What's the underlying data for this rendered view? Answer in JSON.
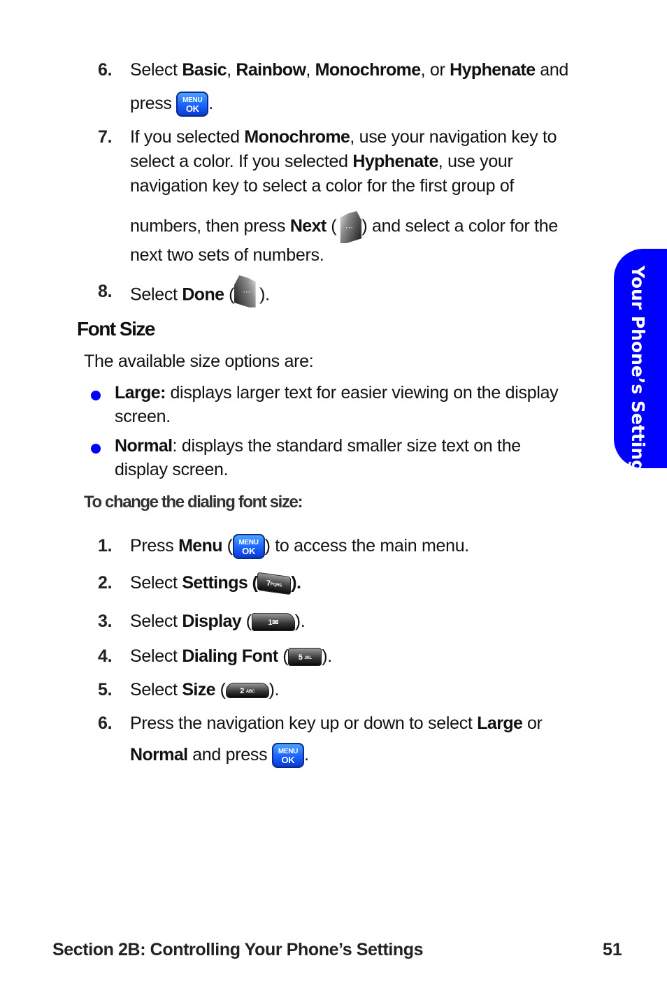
{
  "steps_top": [
    {
      "number": "6.",
      "parts": {
        "a": "Select ",
        "b1": "Basic",
        "c": ", ",
        "b2": "Rainbow",
        "d": ", ",
        "b3": "Monochrome",
        "e": ", or ",
        "b4": "Hyphenate",
        "f": " and",
        "g": "press ",
        "h": "."
      }
    },
    {
      "number": "7.",
      "parts": {
        "a": "If you selected ",
        "b1": "Monochrome",
        "c": ", use your navigation key to",
        "d": "select a color. If you selected ",
        "b2": "Hyphenate",
        "e": ", use your",
        "f": "navigation key to select a color for the first group of",
        "g": "numbers, then press ",
        "b3": "Next",
        "h": " (",
        "i": ") and select a color for the",
        "j": "next two sets of numbers."
      }
    },
    {
      "number": "8.",
      "parts": {
        "a": "Select ",
        "b1": "Done",
        "c": " (",
        "d": ")."
      }
    }
  ],
  "section": {
    "heading": "Font Size",
    "intro": "The available size options are:",
    "bullets": [
      {
        "term": "Large:",
        "text": " displays larger text for easier viewing on the display",
        "text2": "screen."
      },
      {
        "term": "Normal",
        "text": ": displays the standard smaller size text on the",
        "text2": "display screen."
      }
    ],
    "subheading": "To change the dialing font size:"
  },
  "steps_bottom": [
    {
      "number": "1.",
      "parts": {
        "a": "Press ",
        "b1": "Menu",
        "c": " (",
        "d": ") to access the main menu."
      }
    },
    {
      "number": "2.",
      "parts": {
        "a": "Select ",
        "b1": "Settings (",
        "d": ")."
      }
    },
    {
      "number": "3.",
      "parts": {
        "a": "Select ",
        "b1": "Display",
        "c": " (",
        "d": ")."
      }
    },
    {
      "number": "4.",
      "parts": {
        "a": "Select ",
        "b1": "Dialing Font",
        "c": " (",
        "d": ")."
      }
    },
    {
      "number": "5.",
      "parts": {
        "a": "Select ",
        "b1": "Size",
        "c": " (",
        "d": ")."
      }
    },
    {
      "number": "6.",
      "parts": {
        "a": "Press the navigation key up or down to select ",
        "b1": "Large",
        "c": " or",
        "b2": "Normal",
        "d": " and press ",
        "e": "."
      }
    }
  ],
  "keys": {
    "menu": {
      "line1": "MENU",
      "line2": "OK",
      "icon": "menu-ok-key-icon"
    },
    "soft": {
      "label": "···",
      "icon": "soft-key-icon"
    },
    "key7": {
      "digit": "7",
      "letters": "PQRS"
    },
    "key1": {
      "digit": "1",
      "symbol": "✉"
    },
    "key5": {
      "digit": "5",
      "letters": "JKL"
    },
    "key2": {
      "digit": "2",
      "letters": "ABC"
    }
  },
  "side_tab": {
    "label": "Your Phone’s Settings",
    "color": "#0000ff"
  },
  "footer": {
    "section": "Section 2B: Controlling Your Phone’s Settings",
    "page_number": "51"
  },
  "colors": {
    "accent": "#0000ff",
    "bullet": "#0000ff"
  }
}
